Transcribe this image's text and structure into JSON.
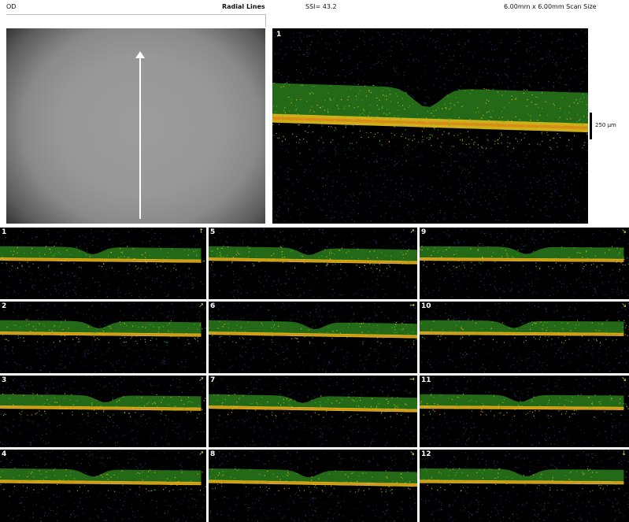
{
  "header": {
    "eye": "OD",
    "scan_type": "Radial Lines",
    "ssi": "SSI= 43.2",
    "scan_size": "6.00mm x 6.00mm Scan Size"
  },
  "main_scan": {
    "number": "1",
    "scale_label": "250 µm"
  },
  "thumbnails": [
    {
      "number": "1",
      "arrow": "↑"
    },
    {
      "number": "2",
      "arrow": "↗"
    },
    {
      "number": "3",
      "arrow": "↗"
    },
    {
      "number": "4",
      "arrow": "↗"
    },
    {
      "number": "5",
      "arrow": "↗"
    },
    {
      "number": "6",
      "arrow": "→"
    },
    {
      "number": "7",
      "arrow": "→"
    },
    {
      "number": "8",
      "arrow": "↘"
    },
    {
      "number": "9",
      "arrow": "↘"
    },
    {
      "number": "10",
      "arrow": "↘"
    },
    {
      "number": "11",
      "arrow": "↘"
    },
    {
      "number": "12",
      "arrow": "↓"
    }
  ],
  "colors": {
    "scan_background": "#000000",
    "retina_green": "#3fbf2a",
    "rpe_yellow": "#e6c21c",
    "rpe_orange": "#d98a1a",
    "noise_blue": "#2a6aa8",
    "arrow_yellow": "#d8e040"
  }
}
